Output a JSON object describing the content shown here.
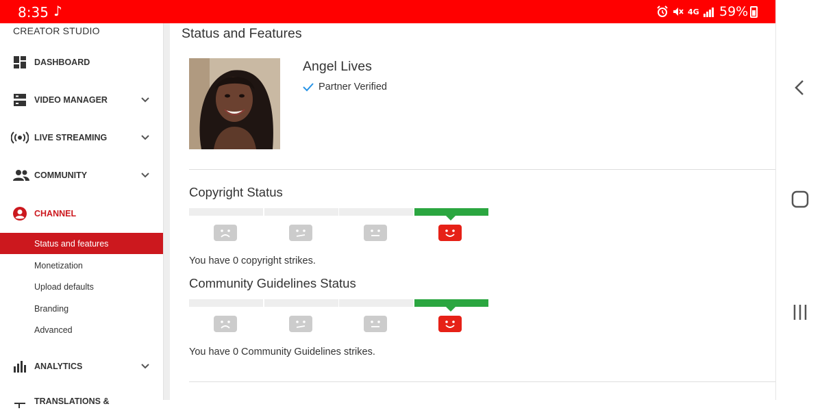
{
  "status_bar": {
    "time": "8:35",
    "battery_percent": "59%",
    "network": "4G",
    "color": "#ff0000"
  },
  "sidebar": {
    "brand": "CREATOR STUDIO",
    "items": [
      {
        "label": "DASHBOARD",
        "icon": "dashboard-icon",
        "expandable": false
      },
      {
        "label": "VIDEO MANAGER",
        "icon": "video-manager-icon",
        "expandable": true
      },
      {
        "label": "LIVE STREAMING",
        "icon": "live-streaming-icon",
        "expandable": true
      },
      {
        "label": "COMMUNITY",
        "icon": "community-icon",
        "expandable": true
      },
      {
        "label": "CHANNEL",
        "icon": "channel-icon",
        "expandable": false,
        "active": true
      },
      {
        "label": "ANALYTICS",
        "icon": "analytics-icon",
        "expandable": true
      },
      {
        "label": "TRANSLATIONS &",
        "icon": "translations-icon",
        "expandable": false
      }
    ],
    "channel_subitems": [
      {
        "label": "Status and features",
        "selected": true
      },
      {
        "label": "Monetization"
      },
      {
        "label": "Upload defaults"
      },
      {
        "label": "Branding"
      },
      {
        "label": "Advanced"
      }
    ],
    "accent_color": "#cc181e"
  },
  "main": {
    "title": "Status and Features",
    "channel": {
      "name": "Angel Lives",
      "verification": "Partner Verified"
    },
    "copyright": {
      "title": "Copyright Status",
      "strike_level": 0,
      "message": "You have 0 copyright strikes."
    },
    "community": {
      "title": "Community Guidelines Status",
      "strike_level": 0,
      "message": "You have 0 Community Guidelines strikes."
    },
    "good_color": "#2ba640",
    "face_active_color": "#e62117",
    "face_inactive_color": "#cccccc"
  },
  "system_nav": {
    "buttons": [
      "back-icon",
      "home-icon",
      "recents-icon"
    ]
  }
}
